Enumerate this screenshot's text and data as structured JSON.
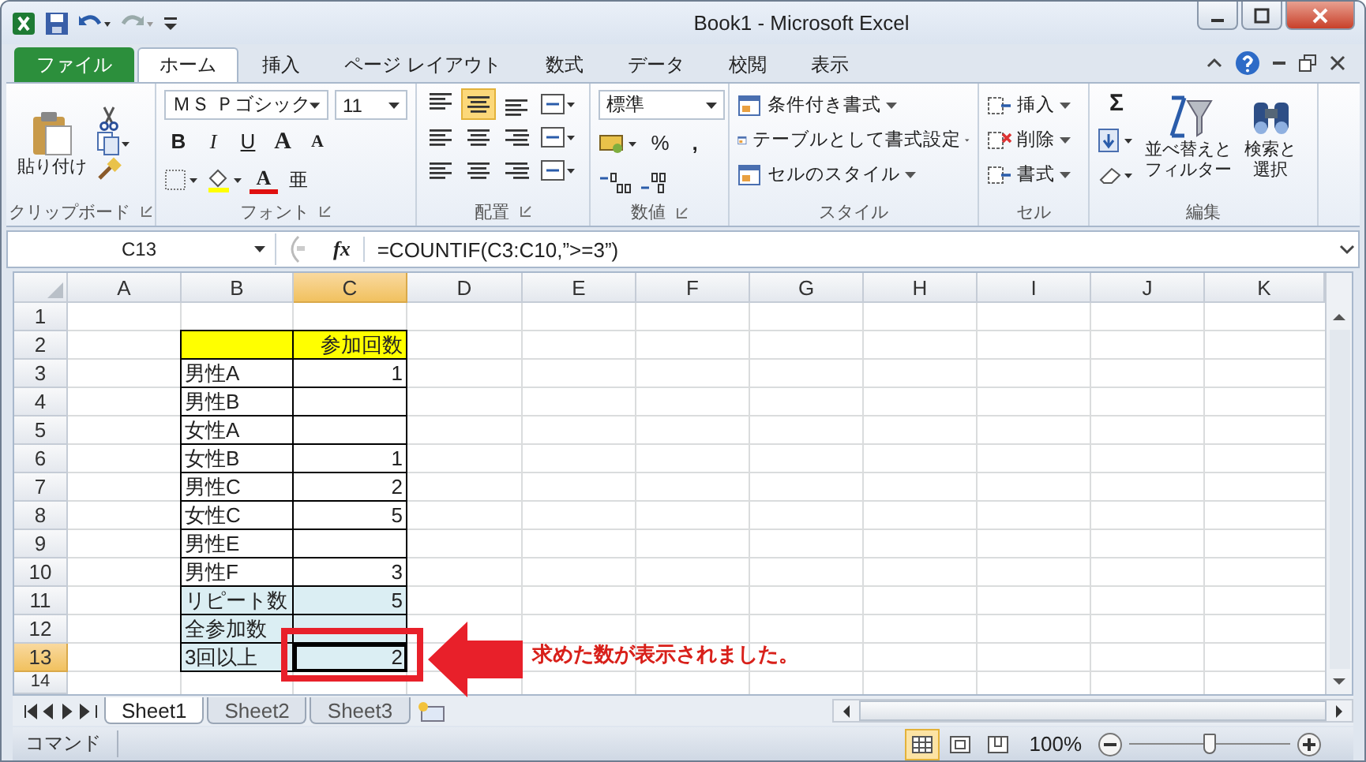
{
  "window": {
    "title": "Book1 - Microsoft Excel"
  },
  "ribbon_tabs": [
    {
      "label": "ファイル",
      "kind": "file",
      "selected": false
    },
    {
      "label": "ホーム",
      "kind": "tab",
      "selected": true
    },
    {
      "label": "挿入",
      "kind": "tab",
      "selected": false
    },
    {
      "label": "ページ レイアウト",
      "kind": "tab",
      "selected": false
    },
    {
      "label": "数式",
      "kind": "tab",
      "selected": false
    },
    {
      "label": "データ",
      "kind": "tab",
      "selected": false
    },
    {
      "label": "校閲",
      "kind": "tab",
      "selected": false
    },
    {
      "label": "表示",
      "kind": "tab",
      "selected": false
    }
  ],
  "clipboard": {
    "label": "クリップボード",
    "paste": "貼り付け"
  },
  "font": {
    "label": "フォント",
    "name": "ＭＳ Ｐゴシック",
    "size": "11",
    "bold": "B",
    "italic": "I",
    "underline": "U",
    "grow": "A",
    "shrink": "A",
    "color_button": "A",
    "phonetic": "亜"
  },
  "alignment": {
    "label": "配置"
  },
  "number": {
    "label": "数値",
    "format": "標準",
    "percent": "%",
    "comma": ","
  },
  "styles": {
    "label": "スタイル",
    "items": [
      "条件付き書式",
      "テーブルとして書式設定",
      "セルのスタイル"
    ]
  },
  "cells": {
    "label": "セル",
    "items": [
      "挿入",
      "削除",
      "書式"
    ]
  },
  "editing": {
    "label": "編集",
    "sigma": "Σ",
    "sort": [
      "並べ替えと",
      "フィルター"
    ],
    "find": [
      "検索と",
      "選択"
    ]
  },
  "formula_bar": {
    "name_box": "C13",
    "fx": "fx",
    "formula": "=COUNTIF(C3:C10,”>=3”)"
  },
  "columns": [
    {
      "label": "A",
      "selected": false
    },
    {
      "label": "B",
      "selected": false
    },
    {
      "label": "C",
      "selected": true
    },
    {
      "label": "D",
      "selected": false
    },
    {
      "label": "E",
      "selected": false
    },
    {
      "label": "F",
      "selected": false
    },
    {
      "label": "G",
      "selected": false
    },
    {
      "label": "H",
      "selected": false
    },
    {
      "label": "I",
      "selected": false
    },
    {
      "label": "J",
      "selected": false
    },
    {
      "label": "K",
      "selected": false
    }
  ],
  "rows": [
    {
      "header": "1",
      "selected": false
    },
    {
      "header": "2",
      "selected": false,
      "table": {
        "value": "参加回数",
        "color": "#ffff00"
      }
    },
    {
      "header": "3",
      "selected": false,
      "table": {
        "label": "男性A",
        "value": "1"
      }
    },
    {
      "header": "4",
      "selected": false,
      "table": {
        "label": "男性B"
      }
    },
    {
      "header": "5",
      "selected": false,
      "table": {
        "label": "女性A"
      }
    },
    {
      "header": "6",
      "selected": false,
      "table": {
        "label": "女性B",
        "value": "1"
      }
    },
    {
      "header": "7",
      "selected": false,
      "table": {
        "label": "男性C",
        "value": "2"
      }
    },
    {
      "header": "8",
      "selected": false,
      "table": {
        "label": "女性C",
        "value": "5"
      }
    },
    {
      "header": "9",
      "selected": false,
      "table": {
        "label": "男性E"
      }
    },
    {
      "header": "10",
      "selected": false,
      "table": {
        "label": "男性F",
        "value": "3"
      }
    },
    {
      "header": "11",
      "selected": false,
      "table": {
        "label": "リピート数",
        "value": "5",
        "color": "#dbeef3"
      }
    },
    {
      "header": "12",
      "selected": false,
      "table": {
        "label": "全参加数",
        "color": "#dbeef3"
      }
    },
    {
      "header": "13",
      "selected": true,
      "table": {
        "label": "3回以上",
        "value": "2",
        "color": "#dbeef3",
        "active": true
      }
    },
    {
      "header": "14",
      "selected": false
    }
  ],
  "sheet_tabs": [
    {
      "label": "Sheet1",
      "selected": true
    },
    {
      "label": "Sheet2",
      "selected": false
    },
    {
      "label": "Sheet3",
      "selected": false
    }
  ],
  "status_bar": {
    "mode": "コマンド",
    "views": [
      {
        "kind": "normal",
        "selected": true
      },
      {
        "kind": "layout",
        "selected": false
      },
      {
        "kind": "pagebreak",
        "selected": false
      }
    ],
    "zoom": "100%",
    "zoom_slider": {
      "level": 0.5
    }
  },
  "callout": {
    "text": "求めた数が表示されました。"
  }
}
